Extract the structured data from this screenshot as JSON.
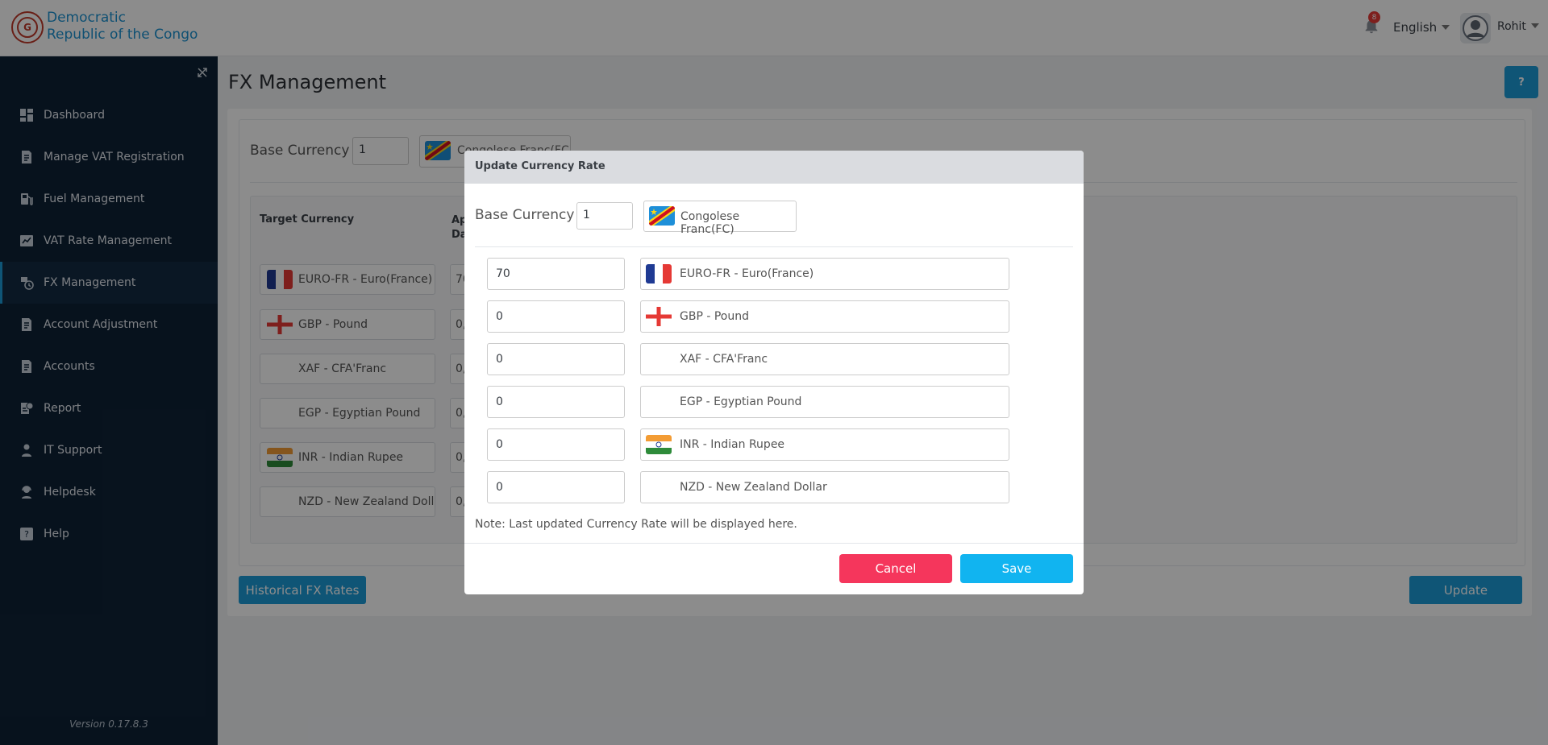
{
  "header": {
    "brand_line1": "Democratic",
    "brand_line2": "Republic of the Congo",
    "notification_count": "8",
    "language": "English",
    "user_name": "Rohit"
  },
  "sidebar": {
    "items": [
      {
        "label": "Dashboard",
        "icon": "dashboard-icon"
      },
      {
        "label": "Manage VAT Registration",
        "icon": "document-icon"
      },
      {
        "label": "Fuel Management",
        "icon": "fuel-icon"
      },
      {
        "label": "VAT Rate Management",
        "icon": "chart-icon"
      },
      {
        "label": "FX Management",
        "icon": "fx-icon"
      },
      {
        "label": "Account Adjustment",
        "icon": "document-icon"
      },
      {
        "label": "Accounts",
        "icon": "document-icon"
      },
      {
        "label": "Report",
        "icon": "report-icon"
      },
      {
        "label": "IT Support",
        "icon": "user-icon"
      },
      {
        "label": "Helpdesk",
        "icon": "helpdesk-icon"
      },
      {
        "label": "Help",
        "icon": "help-icon"
      }
    ],
    "active_index": 4,
    "version": "Version 0.17.8.3"
  },
  "page": {
    "title": "FX Management",
    "help_label": "?",
    "base_currency_label": "Base Currency",
    "base_currency_value": "1",
    "base_currency_name": "Congolese Franc(FC)",
    "table": {
      "col_target": "Target Currency",
      "col_applied_line1": "Ap",
      "col_applied_line2": "Da",
      "rows": [
        {
          "currency": "EURO-FR - Euro(France)",
          "rate": "70",
          "flag": "france"
        },
        {
          "currency": "GBP - Pound",
          "rate": "0,",
          "flag": "england"
        },
        {
          "currency": "XAF - CFA'Franc",
          "rate": "0,",
          "flag": "none"
        },
        {
          "currency": "EGP - Egyptian Pound",
          "rate": "0,",
          "flag": "none"
        },
        {
          "currency": "INR - Indian Rupee",
          "rate": "0,",
          "flag": "india"
        },
        {
          "currency": "NZD - New Zealand Dollar",
          "rate": "0,",
          "flag": "none"
        }
      ]
    },
    "historical_button": "Historical FX Rates",
    "update_button": "Update"
  },
  "modal": {
    "title": "Update Currency Rate",
    "base_currency_label": "Base Currency",
    "base_currency_value": "1",
    "base_currency_name": "Congolese Franc(FC)",
    "rows": [
      {
        "rate": "70",
        "currency": "EURO-FR - Euro(France)",
        "flag": "france"
      },
      {
        "rate": "0",
        "currency": "GBP - Pound",
        "flag": "england"
      },
      {
        "rate": "0",
        "currency": "XAF - CFA'Franc",
        "flag": "none"
      },
      {
        "rate": "0",
        "currency": "EGP - Egyptian Pound",
        "flag": "none"
      },
      {
        "rate": "0",
        "currency": "INR - Indian Rupee",
        "flag": "india"
      },
      {
        "rate": "0",
        "currency": "NZD - New Zealand Dollar",
        "flag": "none"
      }
    ],
    "note": "Note:  Last updated Currency Rate will be displayed here.",
    "cancel_label": "Cancel",
    "save_label": "Save"
  },
  "colors": {
    "sidebar_bg": "#0e2236",
    "accent": "#1d9bd8",
    "cancel": "#f5365c",
    "save": "#11b4f0",
    "brand": "#1d93d1"
  }
}
